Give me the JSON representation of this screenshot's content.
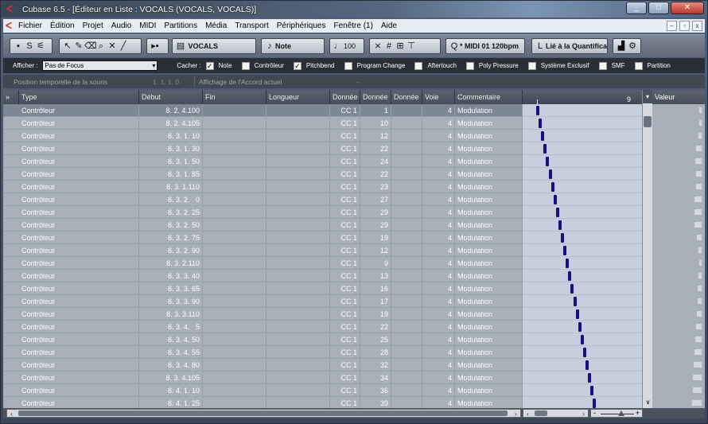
{
  "window": {
    "title": "Cubase 6.5 - [Éditeur en Liste : VOCALS (VOCALS, VOCALS)]"
  },
  "menu": [
    "Fichier",
    "Édition",
    "Projet",
    "Audio",
    "MIDI",
    "Partitions",
    "Média",
    "Transport",
    "Périphériques",
    "Fenêtre (1)",
    "Aide"
  ],
  "toolbar": {
    "track": "VOCALS",
    "insert_type": "Note",
    "velocity": "100",
    "midi_ports": "* MIDI 01  120bpm",
    "quantize": "Lié à la Quantificat"
  },
  "filter": {
    "afficher_label": "Afficher :",
    "focus_value": "Pas de Focus",
    "cacher_label": "Cacher :",
    "checks": [
      {
        "label": "Note",
        "checked": true
      },
      {
        "label": "Contrôleur",
        "checked": false
      },
      {
        "label": "Pitchbend",
        "checked": true
      },
      {
        "label": "Program Change",
        "checked": false
      },
      {
        "label": "Aftertouch",
        "checked": false
      },
      {
        "label": "Poly Pressure",
        "checked": false
      },
      {
        "label": "Système Exclusif",
        "checked": false
      },
      {
        "label": "SMF",
        "checked": false
      },
      {
        "label": "Partition",
        "checked": false
      }
    ]
  },
  "info": {
    "mouse_pos_label": "Position temporelle de la souris",
    "mouse_pos_value": "1. 1. 1.   0",
    "chord_label": "Affichage de l'Accord actuel",
    "chord_value": "--"
  },
  "columns": {
    "type": "Type",
    "debut": "Début",
    "fin": "Fin",
    "longueur": "Longueur",
    "d1": "Donnée",
    "d2": "Donnée",
    "d3": "Donnée",
    "voie": "Voie",
    "commentaire": "Commentaire",
    "valeur": "Valeur"
  },
  "ruler_mark": "9",
  "events": [
    {
      "type": "Contrôleur",
      "start": "8. 2. 4.100",
      "cc": "CC 1",
      "val": "1",
      "ch": "4",
      "comment": "Modulation"
    },
    {
      "type": "Contrôleur",
      "start": "8. 2. 4.105",
      "cc": "CC 1",
      "val": "10",
      "ch": "4",
      "comment": "Modulation"
    },
    {
      "type": "Contrôleur",
      "start": "8. 3. 1. 10",
      "cc": "CC 1",
      "val": "12",
      "ch": "4",
      "comment": "Modulation"
    },
    {
      "type": "Contrôleur",
      "start": "8. 3. 1. 30",
      "cc": "CC 1",
      "val": "22",
      "ch": "4",
      "comment": "Modulation"
    },
    {
      "type": "Contrôleur",
      "start": "8. 3. 1. 50",
      "cc": "CC 1",
      "val": "24",
      "ch": "4",
      "comment": "Modulation"
    },
    {
      "type": "Contrôleur",
      "start": "8. 3. 1. 85",
      "cc": "CC 1",
      "val": "22",
      "ch": "4",
      "comment": "Modulation"
    },
    {
      "type": "Contrôleur",
      "start": "8. 3. 1.110",
      "cc": "CC 1",
      "val": "23",
      "ch": "4",
      "comment": "Modulation"
    },
    {
      "type": "Contrôleur",
      "start": "8. 3. 2.   0",
      "cc": "CC 1",
      "val": "27",
      "ch": "4",
      "comment": "Modulation"
    },
    {
      "type": "Contrôleur",
      "start": "8. 3. 2. 25",
      "cc": "CC 1",
      "val": "29",
      "ch": "4",
      "comment": "Modulation"
    },
    {
      "type": "Contrôleur",
      "start": "8. 3. 2. 50",
      "cc": "CC 1",
      "val": "29",
      "ch": "4",
      "comment": "Modulation"
    },
    {
      "type": "Contrôleur",
      "start": "8. 3. 2. 75",
      "cc": "CC 1",
      "val": "19",
      "ch": "4",
      "comment": "Modulation"
    },
    {
      "type": "Contrôleur",
      "start": "8. 3. 2. 90",
      "cc": "CC 1",
      "val": "12",
      "ch": "4",
      "comment": "Modulation"
    },
    {
      "type": "Contrôleur",
      "start": "8. 3. 2.110",
      "cc": "CC 1",
      "val": "9",
      "ch": "4",
      "comment": "Modulation"
    },
    {
      "type": "Contrôleur",
      "start": "8. 3. 3. 40",
      "cc": "CC 1",
      "val": "13",
      "ch": "4",
      "comment": "Modulation"
    },
    {
      "type": "Contrôleur",
      "start": "8. 3. 3. 65",
      "cc": "CC 1",
      "val": "16",
      "ch": "4",
      "comment": "Modulation"
    },
    {
      "type": "Contrôleur",
      "start": "8. 3. 3. 90",
      "cc": "CC 1",
      "val": "17",
      "ch": "4",
      "comment": "Modulation"
    },
    {
      "type": "Contrôleur",
      "start": "8. 3. 3.110",
      "cc": "CC 1",
      "val": "19",
      "ch": "4",
      "comment": "Modulation"
    },
    {
      "type": "Contrôleur",
      "start": "8. 3. 4.   5",
      "cc": "CC 1",
      "val": "22",
      "ch": "4",
      "comment": "Modulation"
    },
    {
      "type": "Contrôleur",
      "start": "8. 3. 4. 50",
      "cc": "CC 1",
      "val": "25",
      "ch": "4",
      "comment": "Modulation"
    },
    {
      "type": "Contrôleur",
      "start": "8. 3. 4. 55",
      "cc": "CC 1",
      "val": "28",
      "ch": "4",
      "comment": "Modulation"
    },
    {
      "type": "Contrôleur",
      "start": "8. 3. 4. 80",
      "cc": "CC 1",
      "val": "32",
      "ch": "4",
      "comment": "Modulation"
    },
    {
      "type": "Contrôleur",
      "start": "8. 3. 4.105",
      "cc": "CC 1",
      "val": "34",
      "ch": "4",
      "comment": "Modulation"
    },
    {
      "type": "Contrôleur",
      "start": "8. 4. 1. 10",
      "cc": "CC 1",
      "val": "36",
      "ch": "4",
      "comment": "Modulation"
    },
    {
      "type": "Contrôleur",
      "start": "8. 4. 1. 25",
      "cc": "CC 1",
      "val": "39",
      "ch": "4",
      "comment": "Modulation"
    }
  ],
  "colors": {
    "event_bar": "#1c0e8a",
    "selected_row": "#7d8896"
  }
}
